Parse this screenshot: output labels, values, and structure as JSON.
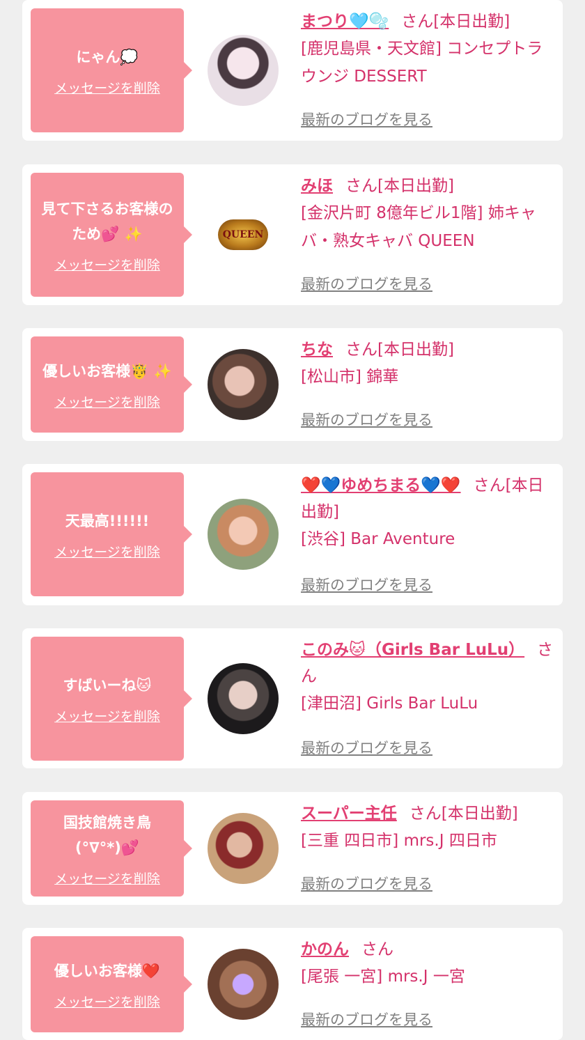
{
  "accent_color": "#f7949e",
  "name_color": "#e23f72",
  "link_color": "#808080",
  "entries": [
    {
      "message": "にゃん💭",
      "delete_label": "メッセージを削除",
      "avatar": "cast-photo",
      "name": "まつり🩵🫧",
      "san": "さん[本日出勤]",
      "shop": "[鹿児島県・天文館] コンセプトラウンジ DESSERT",
      "blog_label": "最新のブログを見る"
    },
    {
      "message": "見て下さるお客様のため💕 ✨",
      "delete_label": "メッセージを削除",
      "avatar": "queen-logo",
      "logo_text": "QUEEN",
      "name": "みほ",
      "san": "さん[本日出勤]",
      "shop": "[金沢片町 8億年ビル1階] 姉キャバ・熟女キャバ QUEEN",
      "blog_label": "最新のブログを見る"
    },
    {
      "message": "優しいお客様🤴 ✨",
      "delete_label": "メッセージを削除",
      "avatar": "cast-photo",
      "name": "ちな",
      "san": "さん[本日出勤]",
      "shop": "[松山市] 錦華",
      "blog_label": "最新のブログを見る"
    },
    {
      "message": "天最高!!!!!!",
      "delete_label": "メッセージを削除",
      "avatar": "cast-photo",
      "name": "❤️💙ゆめちまる💙❤️",
      "san": "さん[本日出勤]",
      "shop": "[渋谷] Bar Aventure",
      "blog_label": "最新のブログを見る"
    },
    {
      "message": "すばいーね🐱",
      "delete_label": "メッセージを削除",
      "avatar": "cast-photo",
      "name": "このみ🐱（Girls Bar LuLu）",
      "san": "さん",
      "shop": "[津田沼] Girls Bar LuLu",
      "blog_label": "最新のブログを見る"
    },
    {
      "message": "国技館焼き鳥\n(°∇°*)💕",
      "delete_label": "メッセージを削除",
      "avatar": "cast-photo",
      "name": "スーパー主任",
      "san": "さん[本日出勤]",
      "shop": "[三重 四日市] mrs.J 四日市",
      "blog_label": "最新のブログを見る"
    },
    {
      "message": "優しいお客様❤️",
      "delete_label": "メッセージを削除",
      "avatar": "cast-photo",
      "name": "かのん",
      "san": "さん",
      "shop": "[尾張 一宮] mrs.J 一宮",
      "blog_label": "最新のブログを見る"
    }
  ]
}
